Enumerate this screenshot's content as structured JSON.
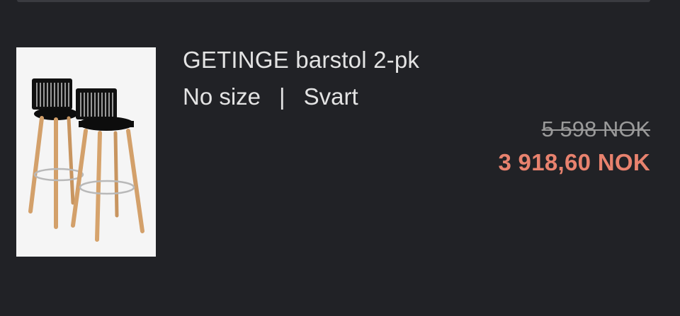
{
  "product": {
    "name": "GETINGE barstol 2-pk",
    "size": "No size",
    "separator": "|",
    "color": "Svart",
    "image_icon": "bar-stool-pair-image",
    "price_original": "5 598 NOK",
    "price_sale": "3 918,60 NOK"
  },
  "colors": {
    "background": "#212226",
    "text": "#e3e3e3",
    "price_original": "#9a9a9a",
    "price_sale": "#e8826e"
  }
}
